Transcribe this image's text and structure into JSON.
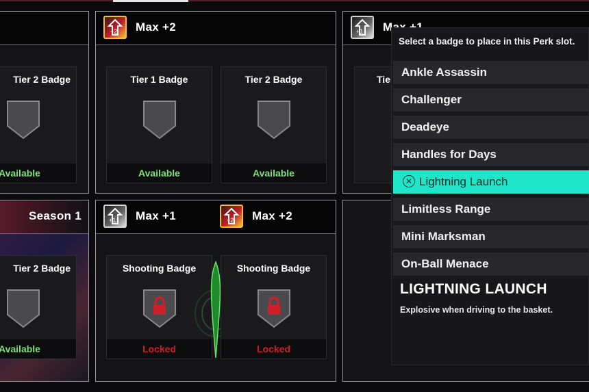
{
  "panels": {
    "top_left": {
      "slots": [
        {
          "title": "Tier 2 Badge",
          "status": "Available"
        }
      ]
    },
    "top_middle": {
      "header": "Max +2",
      "slots": [
        {
          "title": "Tier 1 Badge",
          "status": "Available"
        },
        {
          "title": "Tier 2 Badge",
          "status": "Available"
        }
      ]
    },
    "top_right": {
      "header": "Max +1",
      "slot_title": "Tier"
    },
    "bottom_left": {
      "header": "Season 1",
      "slots": [
        {
          "title": "Tier 2 Badge",
          "status": "Available"
        }
      ]
    },
    "bottom_middle": {
      "headers": [
        "Max +1",
        "Max +2"
      ],
      "slots": [
        {
          "title": "Shooting Badge",
          "status": "Locked"
        },
        {
          "title": "Shooting Badge",
          "status": "Locked"
        }
      ]
    }
  },
  "dropdown": {
    "header": "Select a badge to place in this Perk slot.",
    "items": [
      "Ankle Assassin",
      "Challenger",
      "Deadeye",
      "Handles for Days",
      "Lightning Launch",
      "Limitless Range",
      "Mini Marksman",
      "On-Ball Menace"
    ],
    "selected_item": "Lightning Launch",
    "detail": {
      "title": "LIGHTNING LAUNCH",
      "description": "Explosive when driving to the basket."
    }
  },
  "colors": {
    "available": "#7fe07a",
    "locked": "#d01e2a",
    "selection": "#1fe6c8",
    "boost_gold": "#f2c230"
  },
  "icons": [
    "boost-gold-icon",
    "boost-silver-icon",
    "badge-shield-icon",
    "lock-icon",
    "cross-button-icon"
  ]
}
